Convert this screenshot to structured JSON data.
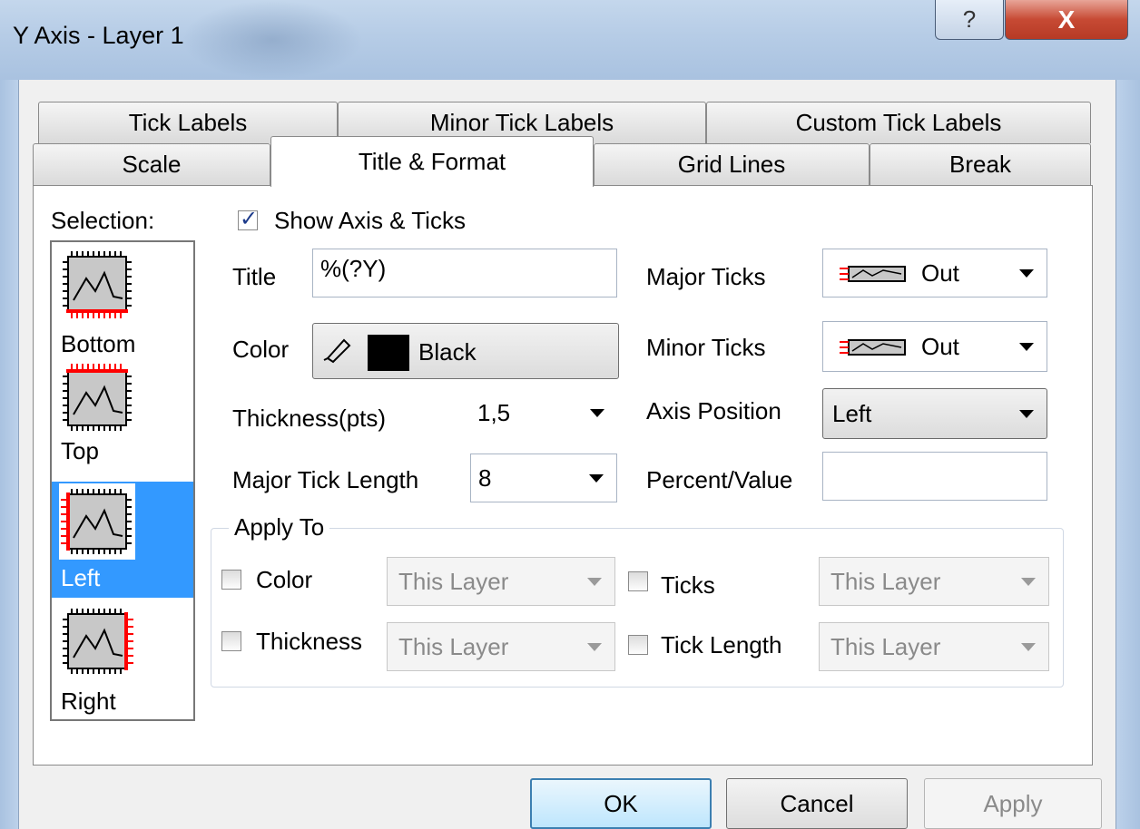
{
  "window": {
    "title": "Y Axis - Layer 1",
    "help_label": "?",
    "close_label": "X"
  },
  "tabs": {
    "row1": [
      "Tick Labels",
      "Minor Tick Labels",
      "Custom Tick Labels"
    ],
    "row2": [
      "Scale",
      "Title & Format",
      "Grid Lines",
      "Break"
    ],
    "active": "Title & Format"
  },
  "selection": {
    "label": "Selection:",
    "items": [
      "Bottom",
      "Top",
      "Left",
      "Right"
    ],
    "selected": "Left"
  },
  "show_axis": {
    "label": "Show Axis & Ticks",
    "checked": true
  },
  "title_field": {
    "label": "Title",
    "value": "%(?Y)"
  },
  "color": {
    "label": "Color",
    "value": "Black",
    "swatch": "#000000"
  },
  "thickness": {
    "label": "Thickness(pts)",
    "value": "1,5"
  },
  "major_tick_length": {
    "label": "Major Tick Length",
    "value": "8"
  },
  "major_ticks": {
    "label": "Major Ticks",
    "value": "Out"
  },
  "minor_ticks": {
    "label": "Minor Ticks",
    "value": "Out"
  },
  "axis_position": {
    "label": "Axis Position",
    "value": "Left"
  },
  "percent_value": {
    "label": "Percent/Value",
    "value": ""
  },
  "apply_to": {
    "legend": "Apply To",
    "color": {
      "label": "Color",
      "value": "This Layer"
    },
    "thickness": {
      "label": "Thickness",
      "value": "This Layer"
    },
    "ticks": {
      "label": "Ticks",
      "value": "This Layer"
    },
    "tick_length": {
      "label": "Tick Length",
      "value": "This Layer"
    }
  },
  "buttons": {
    "ok": "OK",
    "cancel": "Cancel",
    "apply": "Apply"
  },
  "colors": {
    "selection_highlight": "#3399ff",
    "axis_red": "#ff0000",
    "close_red": "#c74a34"
  }
}
